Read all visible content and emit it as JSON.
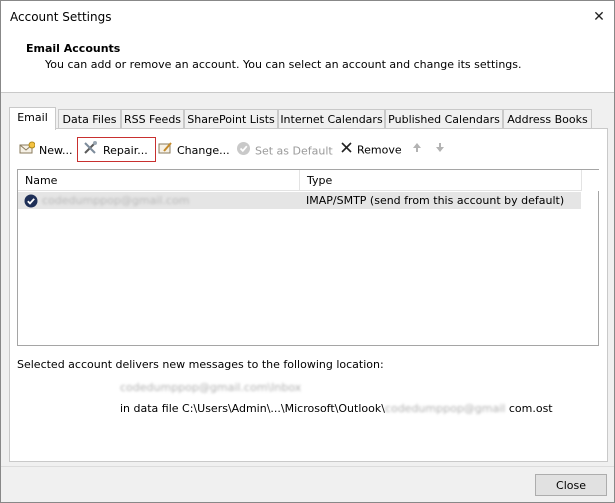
{
  "window": {
    "title": "Account Settings",
    "close_glyph": "✕"
  },
  "header": {
    "title": "Email Accounts",
    "description": "You can add or remove an account. You can select an account and change its settings."
  },
  "tabs": [
    {
      "label": "Email",
      "active": true
    },
    {
      "label": "Data Files"
    },
    {
      "label": "RSS Feeds"
    },
    {
      "label": "SharePoint Lists"
    },
    {
      "label": "Internet Calendars"
    },
    {
      "label": "Published Calendars"
    },
    {
      "label": "Address Books"
    }
  ],
  "toolbar": {
    "new_label": "New...",
    "repair_label": "Repair...",
    "change_label": "Change...",
    "set_default_label": "Set as Default",
    "remove_label": "Remove",
    "move_up_icon": "arrow-up-icon",
    "move_down_icon": "arrow-down-icon"
  },
  "accounts": {
    "columns": {
      "name": "Name",
      "type": "Type"
    },
    "rows": [
      {
        "name": "codedumppop@gmail.com",
        "type": "IMAP/SMTP (send from this account by default)",
        "icon": "default-account-check-icon"
      }
    ]
  },
  "delivery": {
    "label": "Selected account delivers new messages to the following location:",
    "folder": "codedumppop@gmail.com\\Inbox",
    "file_prefix": "in data file C:\\Users\\Admin\\...\\Microsoft\\Outlook\\",
    "file_blurred": "codedumppop@gmail",
    "file_suffix": " com.ost"
  },
  "footer": {
    "close_label": "Close"
  },
  "colors": {
    "highlight_frame": "#c8302f",
    "selected_row": "#e5e5e5"
  }
}
